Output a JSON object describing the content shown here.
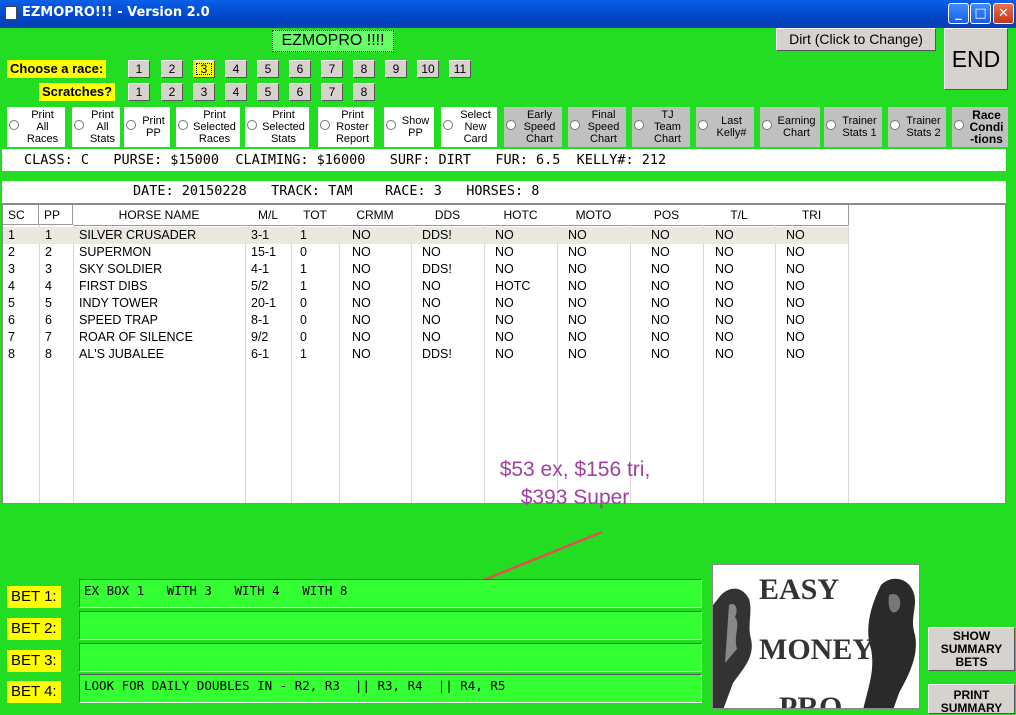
{
  "window": {
    "title": "EZMOPRO!!! - Version 2.0"
  },
  "app_name": "EZMOPRO !!!!",
  "surface_button": "Dirt (Click to Change)",
  "end_button": "END",
  "race_selector": {
    "label": "Choose  a race:",
    "races": [
      "1",
      "2",
      "3",
      "4",
      "5",
      "6",
      "7",
      "8",
      "9",
      "10",
      "11"
    ],
    "selected": "3"
  },
  "scratches": {
    "label": "Scratches?",
    "items": [
      "1",
      "2",
      "3",
      "4",
      "5",
      "6",
      "7",
      "8"
    ]
  },
  "options": [
    {
      "label": "Print\nAll\nRaces",
      "style": "white"
    },
    {
      "label": "Print\nAll\nStats",
      "style": "white"
    },
    {
      "label": "Print\nPP",
      "style": "white"
    },
    {
      "label": "Print\nSelected\nRaces",
      "style": "white"
    },
    {
      "label": "Print\nSelected\nStats",
      "style": "white"
    },
    {
      "label": "Print\nRoster\nReport",
      "style": "white"
    },
    {
      "label": "Show\nPP",
      "style": "white"
    },
    {
      "label": "Select\nNew\nCard",
      "style": "white"
    },
    {
      "label": "Early\nSpeed\nChart",
      "style": "gray"
    },
    {
      "label": "Final\nSpeed\nChart",
      "style": "gray"
    },
    {
      "label": "TJ\nTeam\nChart",
      "style": "gray"
    },
    {
      "label": "Last\nKelly#",
      "style": "gray"
    },
    {
      "label": "Earning\nChart",
      "style": "gray"
    },
    {
      "label": "Trainer\nStats 1",
      "style": "gray"
    },
    {
      "label": "Trainer\nStats 2",
      "style": "gray"
    },
    {
      "label": "Race\nCondi\n-tions",
      "style": "gray-bold"
    }
  ],
  "race_info": "CLASS: C   PURSE: $15000  CLAIMING: $16000   SURF: DIRT   FUR: 6.5  KELLY#: 212",
  "race_header": "DATE: 20150228   TRACK: TAM    RACE: 3   HORSES: 8",
  "table": {
    "columns": [
      "SC",
      "PP",
      "HORSE NAME",
      "M/L",
      "TOT",
      "CRMM",
      "DDS",
      "HOTC",
      "MOTO",
      "POS",
      "T/L",
      "TRI"
    ],
    "rows": [
      [
        "1",
        "1",
        "SILVER CRUSADER",
        "3-1",
        "1",
        "NO",
        "DDS!",
        "NO",
        "NO",
        "NO",
        "NO",
        "NO"
      ],
      [
        "2",
        "2",
        "SUPERMON",
        "15-1",
        "0",
        "NO",
        "NO",
        "NO",
        "NO",
        "NO",
        "NO",
        "NO"
      ],
      [
        "3",
        "3",
        "SKY SOLDIER",
        "4-1",
        "1",
        "NO",
        "DDS!",
        "NO",
        "NO",
        "NO",
        "NO",
        "NO"
      ],
      [
        "4",
        "4",
        "FIRST DIBS",
        "5/2",
        "1",
        "NO",
        "NO",
        "HOTC",
        "NO",
        "NO",
        "NO",
        "NO"
      ],
      [
        "5",
        "5",
        "INDY TOWER",
        "20-1",
        "0",
        "NO",
        "NO",
        "NO",
        "NO",
        "NO",
        "NO",
        "NO"
      ],
      [
        "6",
        "6",
        "SPEED TRAP",
        "8-1",
        "0",
        "NO",
        "NO",
        "NO",
        "NO",
        "NO",
        "NO",
        "NO"
      ],
      [
        "7",
        "7",
        "ROAR OF SILENCE",
        "9/2",
        "0",
        "NO",
        "NO",
        "NO",
        "NO",
        "NO",
        "NO",
        "NO"
      ],
      [
        "8",
        "8",
        "AL'S JUBALEE",
        "6-1",
        "1",
        "NO",
        "DDS!",
        "NO",
        "NO",
        "NO",
        "NO",
        "NO"
      ]
    ]
  },
  "annotation": {
    "line1": "$53 ex, $156 tri,",
    "line2": "$393 Super",
    "color": "#a040a0",
    "arrow_color": "#e05050"
  },
  "bets": [
    {
      "label": "BET 1:",
      "value": "EX BOX 1   WITH 3   WITH 4   WITH 8"
    },
    {
      "label": "BET 2:",
      "value": ""
    },
    {
      "label": "BET 3:",
      "value": ""
    },
    {
      "label": "BET 4:",
      "value": "LOOK FOR DAILY DOUBLES IN - R2, R3  || R3, R4  || R4, R5"
    }
  ],
  "logo": {
    "line1": "EASY",
    "line2": "MONEY",
    "line3": "PRO"
  },
  "show_summary_button": "SHOW\nSUMMARY\nBETS",
  "print_summary_button": "PRINT\nSUMMARY"
}
